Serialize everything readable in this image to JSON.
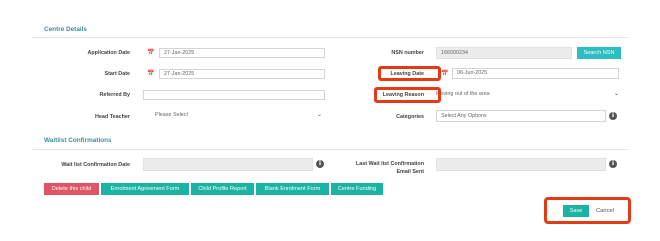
{
  "sections": {
    "centre_details": "Centre Details",
    "waitlist": "Waitlist Confirmations"
  },
  "form": {
    "application_date_label": "Application Date",
    "application_date_value": "27-Jan-2025",
    "start_date_label": "Start Date",
    "start_date_value": "27-Jan-2025",
    "referred_by_label": "Referred By",
    "referred_by_value": "",
    "head_teacher_label": "Head Teacher",
    "head_teacher_value": "Please Select",
    "nsn_label": "NSN number",
    "nsn_value": "166000234",
    "search_nsn_button": "Search NSN",
    "leaving_date_label": "Leaving Date",
    "leaving_date_value": "06-Jun-2025",
    "leaving_reason_label": "Leaving Reason",
    "leaving_reason_value": "Moving out of the area",
    "categories_label": "Categories",
    "categories_placeholder": "Select Any Options"
  },
  "waitlist": {
    "confirmation_date_label": "Wait list Confirmation Date",
    "last_confirmation_label_line1": "Last Wait list Confirmation",
    "last_confirmation_label_line2": "Email Sent"
  },
  "actions": {
    "delete_child": "Delete this child",
    "enrolment_agreement": "Enrolment Agreement Form",
    "child_profile_report": "Child Profile Report",
    "blank_enrolment": "Blank Enrolment Form",
    "centre_funding": "Centre Funding",
    "save": "Save",
    "cancel": "Cancel"
  },
  "colors": {
    "section_title": "#3a8f9c",
    "teal_button": "#1bb3a3",
    "delete_button": "#e05563",
    "search_button": "#2bbec3",
    "highlight": "#e23b16"
  },
  "icons": {
    "calendar": "calendar-icon",
    "chevron": "chevron-down-icon",
    "info": "info-icon"
  }
}
